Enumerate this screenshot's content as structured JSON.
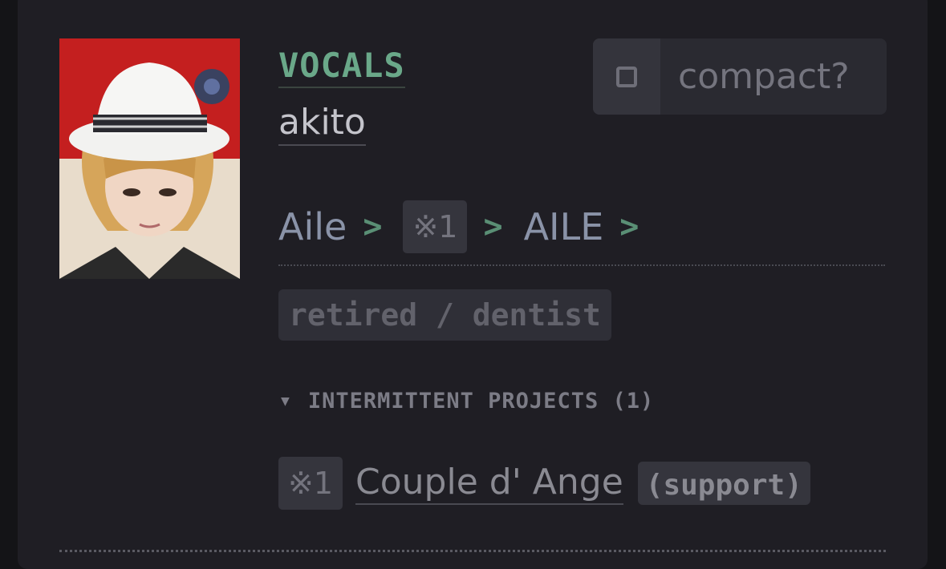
{
  "member": {
    "role": "VOCALS",
    "name": "akito",
    "photo_alt": "akito"
  },
  "compact_toggle": {
    "label": "compact?",
    "checked": false
  },
  "band_path": {
    "items": [
      {
        "type": "band",
        "label": "Aile"
      },
      {
        "type": "tag",
        "label": "※1"
      },
      {
        "type": "band",
        "label": "AILE"
      }
    ],
    "separator": ">"
  },
  "status": "retired / dentist",
  "projects": {
    "heading": "INTERMITTENT PROJECTS (1)",
    "expand_glyph": "▼",
    "items": [
      {
        "tag": "※1",
        "name": "Couple d' Ange",
        "note": "(support)"
      }
    ]
  },
  "colors": {
    "accent_green": "#6aa889",
    "card_bg": "#1f1e24",
    "photo_bg": "#c41f1f"
  }
}
